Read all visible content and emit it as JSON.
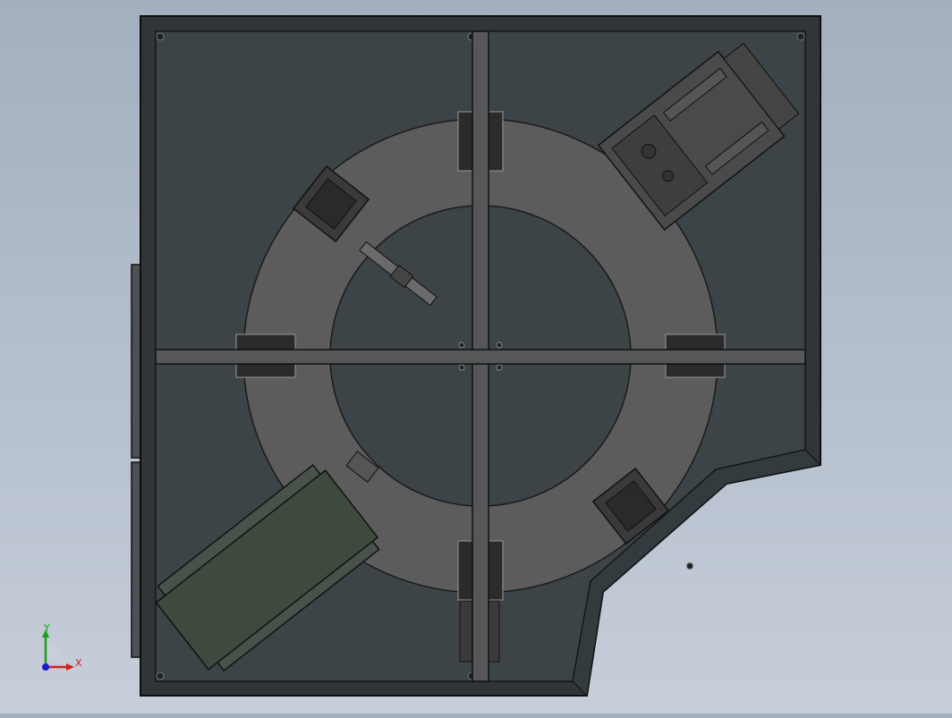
{
  "colors": {
    "background_top": "#a3afbf",
    "background_bottom": "#c6ced9",
    "plate": "#3c4448",
    "plate_border": "#111416",
    "ring": "#5c5c5c",
    "beam": "#555759",
    "module_dark": "#4a4a4a",
    "module_green": "#3e4a3e",
    "axis_x": "#d42020",
    "axis_y": "#1aa01a",
    "axis_z": "#1b1bd0"
  },
  "scene": {
    "description_icon": "cad-model-top-view-icon",
    "view": "top"
  },
  "triad": {
    "x_label": "X",
    "y_label": "Y"
  }
}
